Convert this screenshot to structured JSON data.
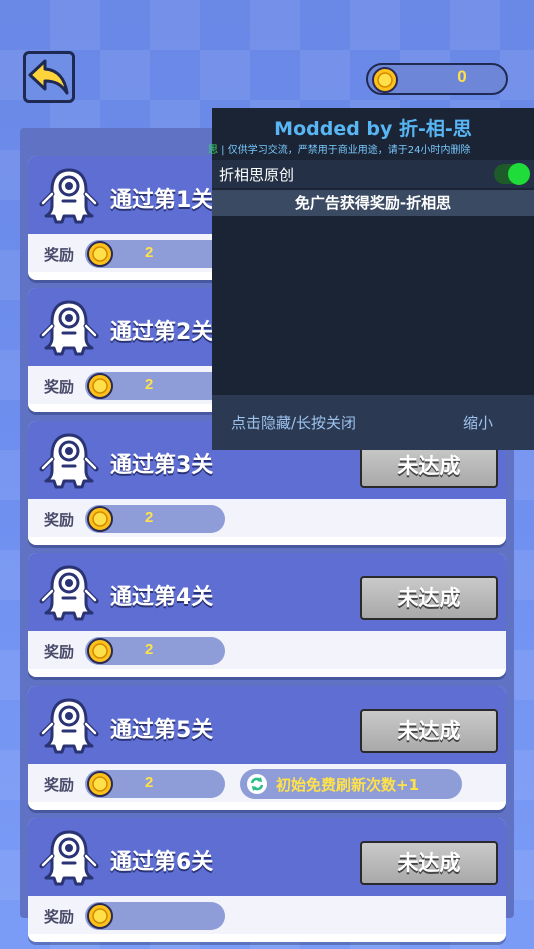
{
  "header": {
    "back_icon": "back-arrow-icon",
    "coins": "0"
  },
  "tasks": [
    {
      "title": "通过第1关",
      "reward_label": "奖励",
      "reward": "2",
      "status": ""
    },
    {
      "title": "通过第2关",
      "reward_label": "奖励",
      "reward": "2",
      "status": ""
    },
    {
      "title": "通过第3关",
      "reward_label": "奖励",
      "reward": "2",
      "status": "未达成"
    },
    {
      "title": "通过第4关",
      "reward_label": "奖励",
      "reward": "2",
      "status": "未达成"
    },
    {
      "title": "通过第5关",
      "reward_label": "奖励",
      "reward": "2",
      "status": "未达成",
      "bonus": "初始免费刷新次数+1"
    },
    {
      "title": "通过第6关",
      "reward_label": "奖励",
      "reward": "",
      "status": "未达成"
    }
  ],
  "mod_menu": {
    "title": "Modded by 折-相-思",
    "notice_prefix": "思",
    "notice": " | 仅供学习交流，严禁用于商业用途，请于24小时内删除",
    "toggle_label": "折相思原创",
    "toggle_on": true,
    "feature": "免广告获得奖励-折相思",
    "hide_label": "点击隐藏/长按关闭",
    "minimize_label": "缩小"
  },
  "colors": {
    "accent": "#ffe14a",
    "card_header": "#5e6ed2",
    "mod_bg": "#1b2434",
    "toggle_on": "#1fdc3a"
  }
}
